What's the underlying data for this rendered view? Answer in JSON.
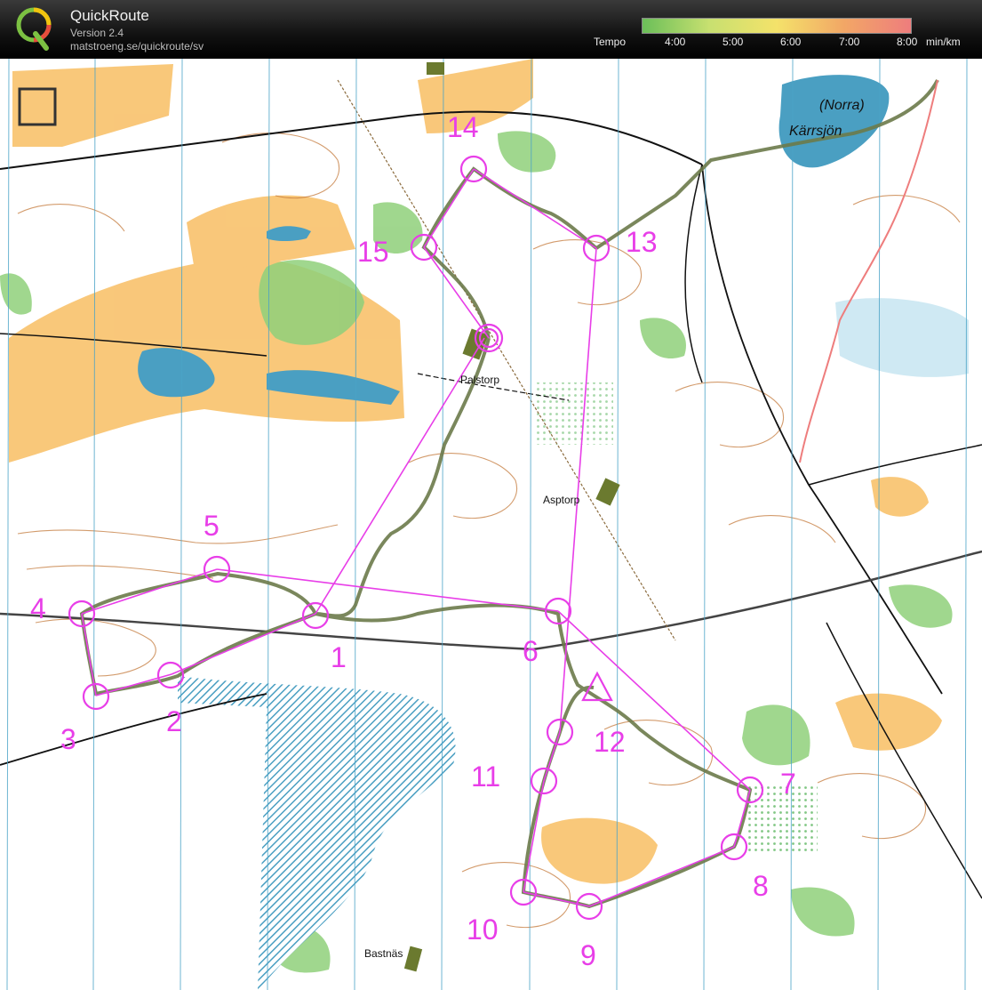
{
  "app": {
    "title": "QuickRoute",
    "version": "Version 2.4",
    "url": "matstroeng.se/quickroute/sv",
    "logo_letter": "Q"
  },
  "tempo": {
    "label": "Tempo",
    "ticks": [
      "4:00",
      "5:00",
      "6:00",
      "7:00",
      "8:00"
    ],
    "unit": "min/km",
    "colors": [
      "#6bbf59",
      "#c8e070",
      "#f4e26a",
      "#f2a766",
      "#ee7d7d"
    ]
  },
  "map": {
    "colors": {
      "course": "#e83ee8",
      "route": "#6b7a4a",
      "water": "#4a9fc2",
      "open": "#f8be63",
      "green": "#8fd07a",
      "contour": "#c47a3b",
      "background": "#ffffff"
    },
    "place_names": {
      "lake": [
        "(Norra)",
        "Kärrsjön"
      ],
      "palstorp": "Palstorp",
      "asptorp": "Asptorp",
      "bastnas": "Bastnäs"
    },
    "controls": [
      "1",
      "2",
      "3",
      "4",
      "5",
      "6",
      "7",
      "8",
      "9",
      "10",
      "11",
      "12",
      "13",
      "14",
      "15"
    ]
  }
}
